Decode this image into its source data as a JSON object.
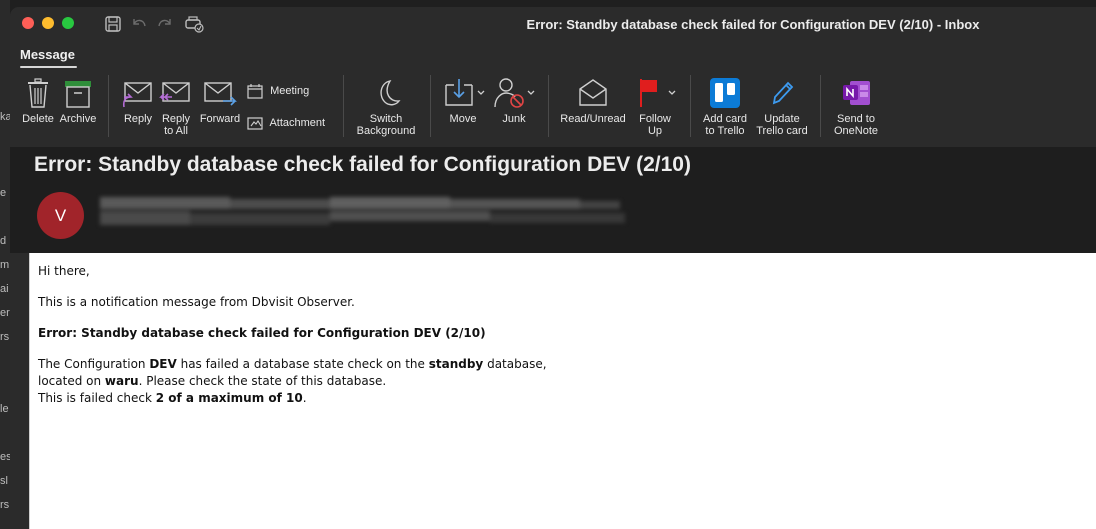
{
  "window": {
    "title": "Error: Standby database check failed for Configuration DEV (2/10) - Inbox"
  },
  "tabs": {
    "message": "Message"
  },
  "ribbon": {
    "delete": "Delete",
    "archive": "Archive",
    "reply": "Reply",
    "reply_all_1": "Reply",
    "reply_all_2": "to All",
    "forward": "Forward",
    "meeting": "Meeting",
    "attachment": "Attachment",
    "switch_bg_1": "Switch",
    "switch_bg_2": "Background",
    "move": "Move",
    "junk": "Junk",
    "read_unread": "Read/Unread",
    "follow_up_1": "Follow",
    "follow_up_2": "Up",
    "add_card_1": "Add card",
    "add_card_2": "to Trello",
    "update_trello_1": "Update",
    "update_trello_2": "Trello card",
    "onenote_1": "Send to",
    "onenote_2": "OneNote"
  },
  "message": {
    "subject": "Error: Standby database check failed for Configuration DEV (2/10)",
    "avatar_initial": "V",
    "greeting": "Hi there,",
    "intro": "This is a notification message from Dbvisit Observer.",
    "heading": "Error: Standby database check failed for Configuration DEV (2/10)",
    "l1_a": "The Configuration ",
    "l1_b": "DEV",
    "l1_c": " has failed a database state check on the ",
    "l1_d": "standby",
    "l1_e": " database,",
    "l2_a": "located on ",
    "l2_b": "waru",
    "l2_c": ". Please check the state of this database.",
    "l3_a": "This is failed check ",
    "l3_b": "2 of a maximum of 10",
    "l3_c": "."
  },
  "background_fragments": [
    "ka",
    "e",
    "d",
    "m",
    "ai",
    "er",
    "rs",
    "le",
    "es",
    "sl",
    "rs"
  ],
  "colors": {
    "avatar": "#a1242a",
    "trello": "#0c7bd6",
    "onenote": "#7719aa",
    "flag": "#e01e1e"
  }
}
